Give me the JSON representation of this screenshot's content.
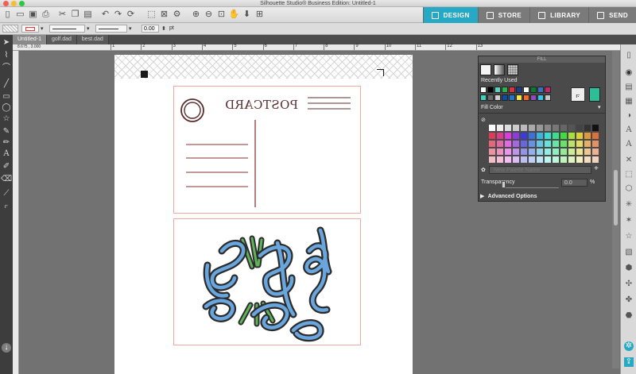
{
  "window": {
    "title": "Silhouette Studio® Business Edition: Untitled-1"
  },
  "nav_tabs": [
    {
      "label": "DESIGN",
      "icon": "grid-icon",
      "active": true
    },
    {
      "label": "STORE",
      "icon": "store-icon",
      "active": false
    },
    {
      "label": "LIBRARY",
      "icon": "library-icon",
      "active": false
    },
    {
      "label": "SEND",
      "icon": "send-icon",
      "active": false
    }
  ],
  "line_width": {
    "value": "0.00",
    "unit": "pt"
  },
  "doc_tabs": [
    {
      "label": "Untitled-1",
      "active": true
    },
    {
      "label": "golf.dad",
      "active": false
    },
    {
      "label": "best.dad",
      "active": false
    }
  ],
  "coords": {
    "readout": "8.675 , 3.000"
  },
  "ruler": {
    "labels": [
      "1",
      "2",
      "3",
      "4",
      "5",
      "6",
      "7",
      "8",
      "9",
      "10",
      "11",
      "12",
      "13"
    ]
  },
  "panel": {
    "title": "FILL",
    "recently_used_label": "Recently Used",
    "fill_color_label": "Fill Color",
    "new_palette_placeholder": "New Palette Name",
    "transparency_label": "Transparency",
    "transparency_value": "0.0",
    "transparency_unit": "%",
    "advanced_label": "Advanced Options",
    "selected_color": "#2ebd96",
    "recent_colors": [
      [
        "#ffffff",
        "#000000",
        "#5bd1c0",
        "#2bb34a",
        "#d9333f",
        "#1e3d82",
        "#ffffff",
        "#0a7a2e",
        "#3a6fc4",
        "#c12a6a"
      ],
      [
        "#3fd0bf",
        "#6a6a6a",
        "#cfcfcf",
        "#0e4ea0",
        "#1f77c9",
        "#f2e84b",
        "#f26b2b",
        "#8a4fb5",
        "#38c4ea",
        "#c7c7c7"
      ]
    ]
  },
  "postcard": {
    "stamp_text": "POSTCARD"
  }
}
